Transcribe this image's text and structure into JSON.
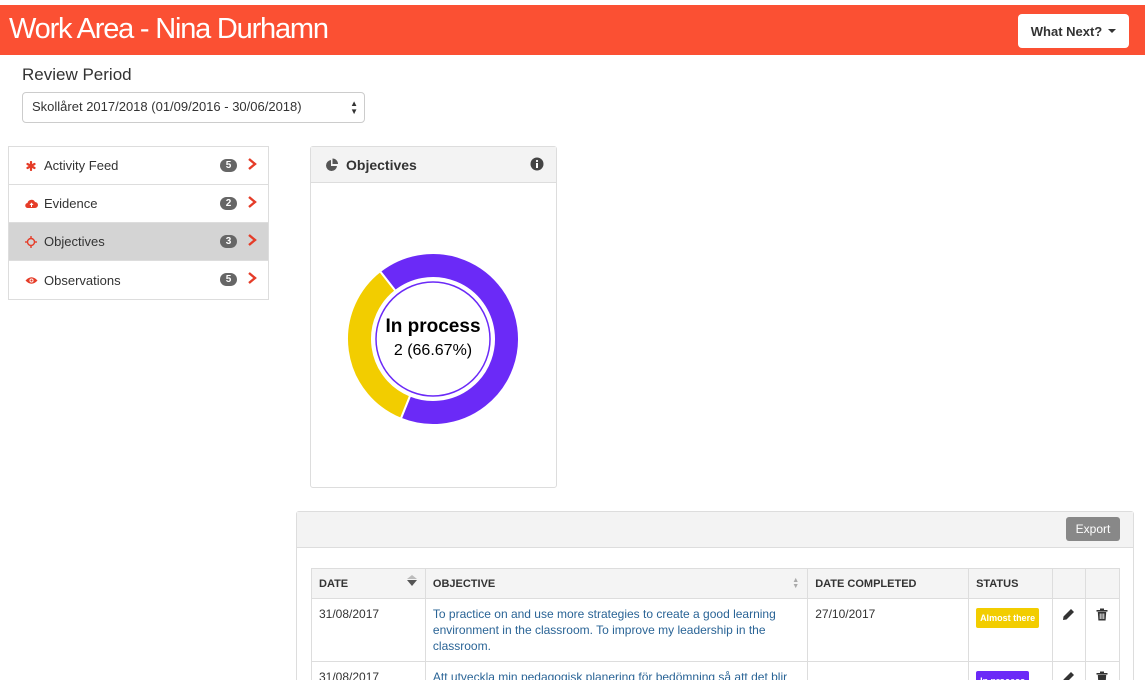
{
  "header": {
    "title": "Work Area - Nina Durhamn",
    "what_next_label": "What Next?"
  },
  "review": {
    "label": "Review Period",
    "selected": "Skollåret 2017/2018 (01/09/2016 - 30/06/2018)"
  },
  "sidebar": {
    "items": [
      {
        "label": "Activity Feed",
        "count": "5",
        "icon": "asterisk-icon",
        "active": false
      },
      {
        "label": "Evidence",
        "count": "2",
        "icon": "cloud-upload-icon",
        "active": false
      },
      {
        "label": "Objectives",
        "count": "3",
        "icon": "crosshair-icon",
        "active": true
      },
      {
        "label": "Observations",
        "count": "5",
        "icon": "eye-icon",
        "active": false
      }
    ]
  },
  "objectives_panel": {
    "title": "Objectives",
    "center_label": "In process",
    "center_value": "2 (66.67%)"
  },
  "chart_data": {
    "type": "pie",
    "style": "donut",
    "categories": [
      "In process",
      "Almost there"
    ],
    "values": [
      2,
      1
    ],
    "colors": [
      "#6b2af7",
      "#f2cd00"
    ]
  },
  "table": {
    "export_label": "Export",
    "columns": [
      "DATE",
      "OBJECTIVE",
      "DATE COMPLETED",
      "STATUS",
      "",
      ""
    ],
    "rows": [
      {
        "date": "31/08/2017",
        "objective": "To practice on and use more strategies to create a good learning environment in the classroom. To improve my leadership in the classroom.",
        "date_completed": "27/10/2017",
        "status": "Almost there",
        "status_color": "#f2cd00"
      },
      {
        "date": "31/08/2017",
        "objective": "Att utveckla min pedagogisk planering för bedömning så att det blir",
        "date_completed": "",
        "status": "In process",
        "status_color": "#6b2af7"
      }
    ]
  }
}
